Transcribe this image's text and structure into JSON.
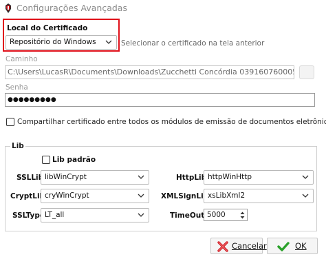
{
  "window": {
    "title": "Configurações Avançadas",
    "icon": "app-logo-icon"
  },
  "certificate": {
    "location_label": "Local do Certificado",
    "location_value": "Repositório do Windows",
    "location_hint": "Selecionar o certificado na tela anterior",
    "path_label": "Caminho",
    "path_value": "C:\\Users\\LucasR\\Documents\\Downloads\\Zucchetti Concórdia 03916076000583",
    "password_label": "Senha",
    "password_value": "●●●●●●●●●",
    "share_label": "Compartilhar certificado entre todos os módulos de emissão de documentos eletrônicos.",
    "share_checked": false
  },
  "lib": {
    "group_label": "Lib",
    "default_label": "Lib padrão",
    "default_checked": false,
    "ssllib_label": "SSLLib",
    "ssllib_value": "libWinCrypt",
    "cryptlib_label": "CryptLib",
    "cryptlib_value": "cryWinCrypt",
    "ssltype_label": "SSLType",
    "ssltype_value": "LT_all",
    "httplib_label": "HttpLib",
    "httplib_value": "httpWinHttp",
    "xmlsignlib_label": "XMLSignLib",
    "xmlsignlib_value": "xsLibXml2",
    "timeout_label": "TimeOut",
    "timeout_value": "5000"
  },
  "buttons": {
    "cancel_label": "Cancelar",
    "ok_label": "OK"
  },
  "colors": {
    "highlight_border": "#e0101a",
    "cancel_icon": "#d0202a",
    "ok_icon": "#2aa12a"
  }
}
